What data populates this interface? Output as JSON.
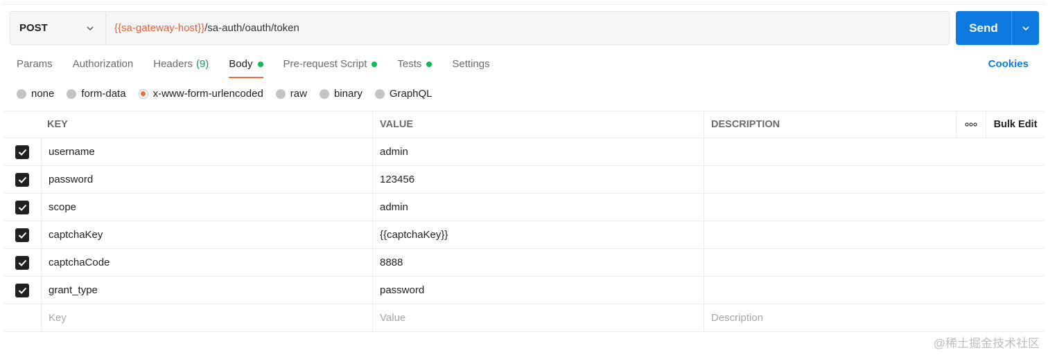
{
  "request": {
    "method": "POST",
    "url_variable": "{{sa-gateway-host}}",
    "url_path": "/sa-auth/oauth/token",
    "send_label": "Send"
  },
  "tabs": [
    {
      "label": "Params"
    },
    {
      "label": "Authorization"
    },
    {
      "label": "Headers",
      "count": "(9)"
    },
    {
      "label": "Body"
    },
    {
      "label": "Pre-request Script"
    },
    {
      "label": "Tests"
    },
    {
      "label": "Settings"
    }
  ],
  "cookies_label": "Cookies",
  "body_types": [
    "none",
    "form-data",
    "x-www-form-urlencoded",
    "raw",
    "binary",
    "GraphQL"
  ],
  "table": {
    "headers": {
      "key": "KEY",
      "value": "VALUE",
      "description": "DESCRIPTION",
      "more": "ooo",
      "bulk_edit": "Bulk Edit"
    },
    "rows": [
      {
        "key": "username",
        "value": "admin"
      },
      {
        "key": "password",
        "value": "123456"
      },
      {
        "key": "scope",
        "value": "admin"
      },
      {
        "key": "captchaKey",
        "value": "{{captchaKey}}"
      },
      {
        "key": "captchaCode",
        "value": "8888"
      },
      {
        "key": "grant_type",
        "value": "password"
      }
    ],
    "placeholders": {
      "key": "Key",
      "value": "Value",
      "description": "Description"
    }
  },
  "colors": {
    "accent": "#0d7ae0",
    "variable": "#e0633a",
    "active_tab": "#f26b3a",
    "status_dot": "#0cbb52"
  },
  "watermark": "@稀土掘金技术社区"
}
